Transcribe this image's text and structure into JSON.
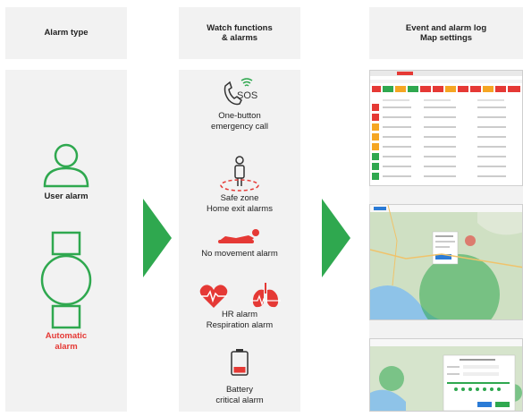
{
  "headers": {
    "alarm_type": "Alarm type",
    "watch_functions": "Watch functions\n& alarms",
    "event_log": "Event and alarm log\nMap settings"
  },
  "alarm_types": {
    "user": "User alarm",
    "automatic": "Automatic\nalarm"
  },
  "functions": {
    "sos_badge": "SOS",
    "emergency": "One-button\nemergency call",
    "safe_zone": "Safe zone\nHome exit alarms",
    "no_movement": "No movement alarm",
    "hr_resp": "HR alarm\nRespiration alarm",
    "battery": "Battery\ncritical alarm"
  },
  "colors": {
    "green": "#2fa84f",
    "red": "#e53935",
    "panel": "#f2f2f2"
  },
  "icons": [
    "user-icon",
    "watch-icon",
    "sos-icon",
    "person-zone-icon",
    "lying-person-icon",
    "heart-icon",
    "lungs-icon",
    "battery-icon"
  ]
}
